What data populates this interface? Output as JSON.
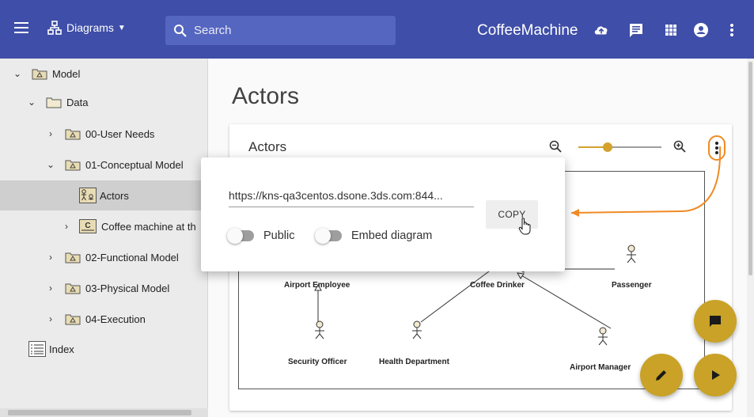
{
  "topbar": {
    "menu_icon": "menu-icon",
    "diagrams_label": "Diagrams",
    "search_placeholder": "Search",
    "app_title": "CoffeeMachine",
    "icons": [
      "cloud-upload-icon",
      "chat-icon",
      "apps-grid-icon",
      "account-icon",
      "more-vert-icon"
    ]
  },
  "sidebar": {
    "items": [
      {
        "label": "Model",
        "expanded": true,
        "icon": "model-folder-icon"
      },
      {
        "label": "Data",
        "expanded": true,
        "icon": "folder-icon"
      },
      {
        "label": "00-User Needs",
        "expanded": false,
        "icon": "model-folder-icon"
      },
      {
        "label": "01-Conceptual Model",
        "expanded": true,
        "icon": "model-folder-icon"
      },
      {
        "label": "Actors",
        "selected": true,
        "icon": "actors-diagram-icon"
      },
      {
        "label": "Coffee machine at th",
        "expanded": false,
        "icon": "class-diagram-icon"
      },
      {
        "label": "02-Functional Model",
        "expanded": false,
        "icon": "model-folder-icon"
      },
      {
        "label": "03-Physical Model",
        "expanded": false,
        "icon": "model-folder-icon"
      },
      {
        "label": "04-Execution",
        "expanded": false,
        "icon": "model-folder-icon"
      },
      {
        "label": "Index",
        "icon": "index-icon"
      }
    ]
  },
  "main": {
    "page_title": "Actors",
    "card_title": "Actors",
    "zoom_level": 0.35,
    "actors": [
      "Airport Employee",
      "Coffee Drinker",
      "Passenger",
      "Security Officer",
      "Health Department",
      "Airport Manager"
    ]
  },
  "share_dialog": {
    "url": "https://kns-qa3centos.dsone.3ds.com:844...",
    "copy_label": "COPY",
    "public_label": "Public",
    "embed_label": "Embed diagram",
    "public_on": false,
    "embed_on": false
  },
  "fabs": [
    "comment-icon",
    "edit-icon",
    "play-icon"
  ],
  "colors": {
    "primary": "#3f4ea8",
    "accent": "#c9a227",
    "highlight": "#f08a24"
  }
}
